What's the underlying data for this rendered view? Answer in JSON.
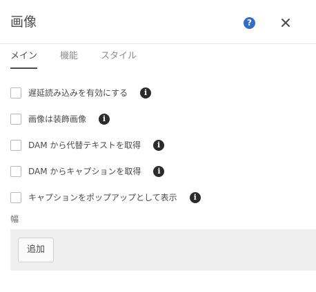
{
  "dialog": {
    "title": "画像",
    "help_glyph": "?",
    "help_color": "#326ec8",
    "close_icon": "close-icon"
  },
  "tabs": [
    {
      "label": "メイン",
      "active": true
    },
    {
      "label": "機能",
      "active": false
    },
    {
      "label": "スタイル",
      "active": false
    }
  ],
  "options": [
    {
      "label": "遅延読み込みを有効にする",
      "checked": false
    },
    {
      "label": "画像は装飾画像",
      "checked": false
    },
    {
      "label": "DAM から代替テキストを取得",
      "checked": false
    },
    {
      "label": "DAM からキャプションを取得",
      "checked": false
    },
    {
      "label": "キャプションをポップアップとして表示",
      "checked": false
    }
  ],
  "info_glyph": "i",
  "width_field": {
    "label": "幅",
    "add_label": "追加"
  }
}
